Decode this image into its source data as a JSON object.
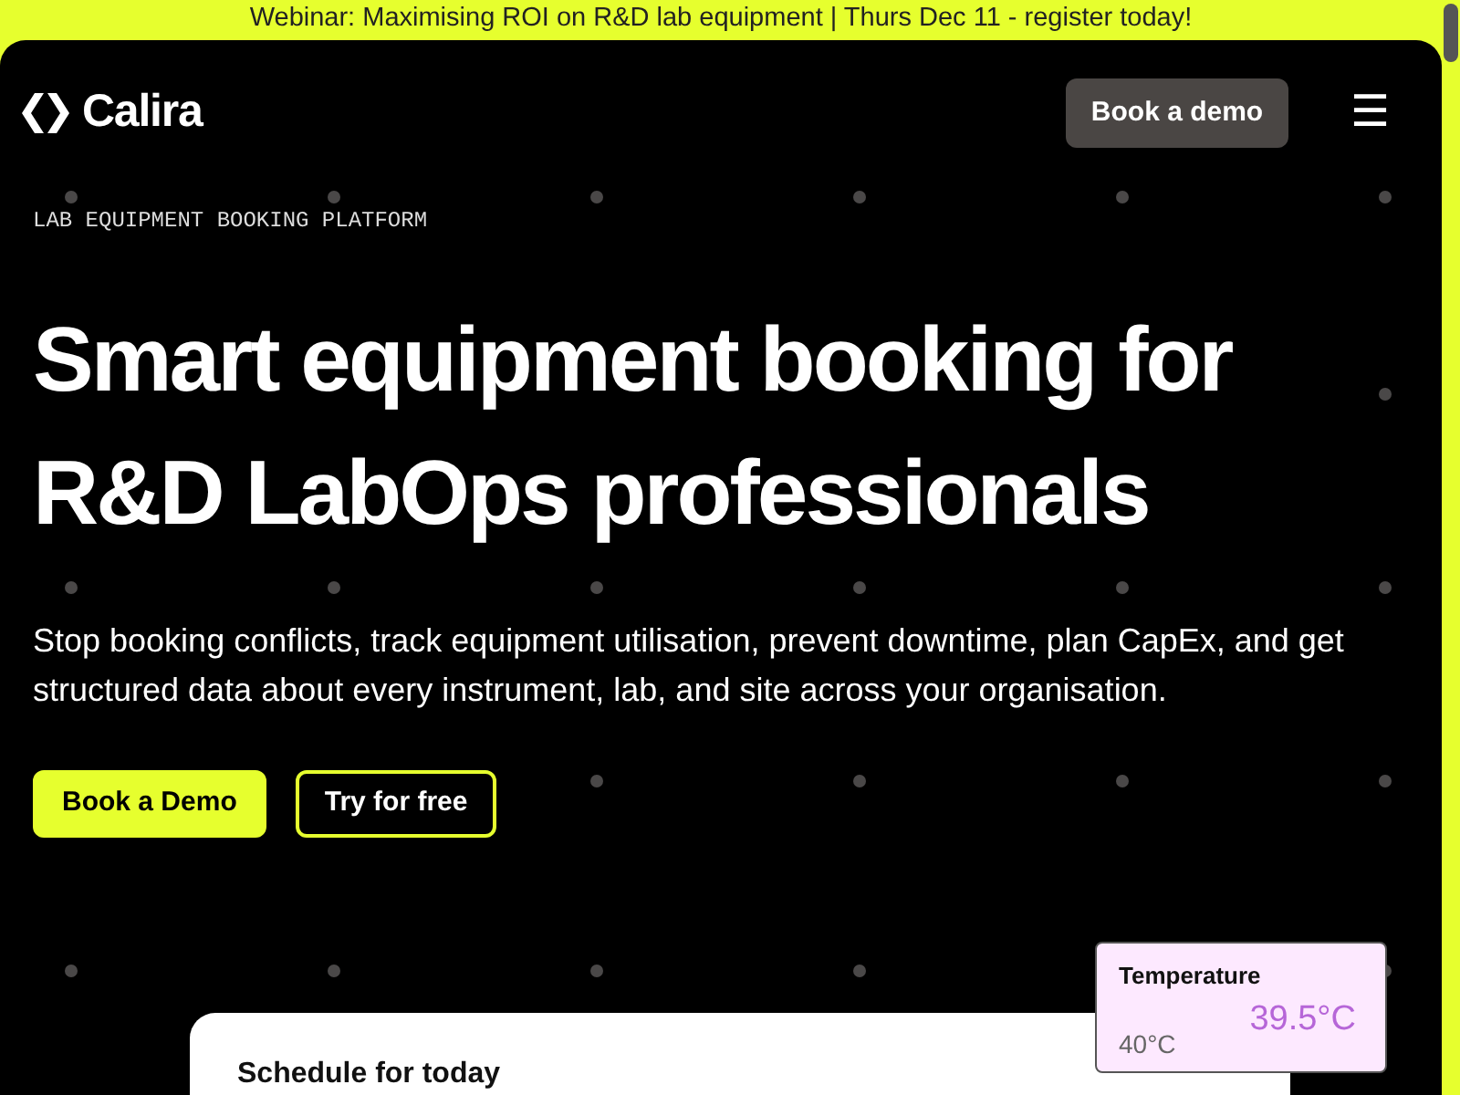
{
  "banner": {
    "text": "Webinar: Maximising ROI on R&D lab equipment | Thurs Dec 11 - register today!"
  },
  "header": {
    "logo": "Calira",
    "cta": "Book a demo",
    "menu_icon": "☰"
  },
  "hero": {
    "eyebrow": "LAB EQUIPMENT BOOKING PLATFORM",
    "title_lines": [
      "Smart equipment booking for",
      "R&D LabOps professionals"
    ],
    "description": "Stop booking conflicts, track equipment utilisation, prevent downtime, plan CapEx, and get structured data about every instrument, lab, and site across your organisation.",
    "buttons": [
      {
        "label": "Book a Demo",
        "kind": "primary"
      },
      {
        "label": "Try for free",
        "kind": "outline"
      }
    ]
  },
  "schedule_card": {
    "title": "Schedule for today"
  },
  "temperature_card": {
    "title": "Temperature",
    "reading": "39.5°C",
    "threshold": "40°C"
  }
}
